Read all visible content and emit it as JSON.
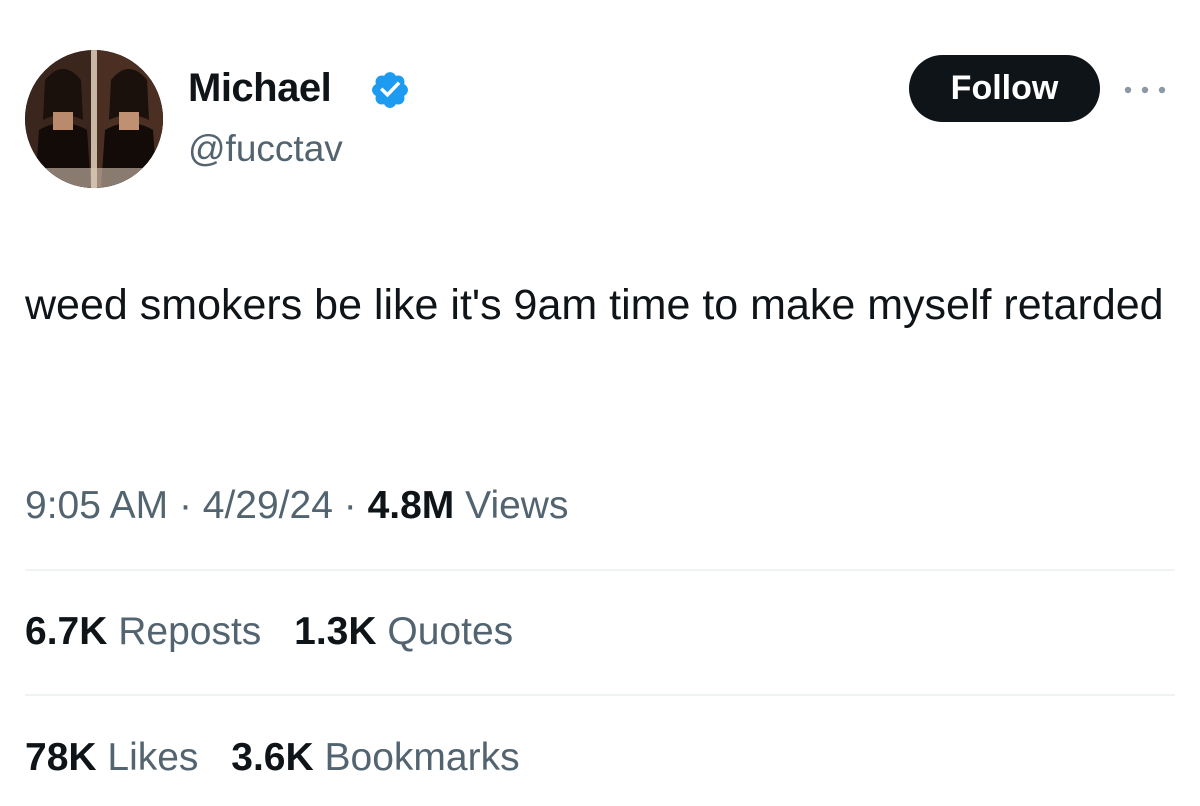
{
  "author": {
    "display_name": "Michael",
    "handle": "@fucctav",
    "verified": true,
    "avatar_icon": "profile-photo",
    "verified_color": "#1d9bf0"
  },
  "follow_button": {
    "label": "Follow"
  },
  "more_icon": "ellipsis-icon",
  "tweet": {
    "text": "weed smokers be like it's 9am time to make myself retarded"
  },
  "meta": {
    "time": "9:05 AM",
    "separator": "·",
    "date": "4/29/24",
    "views_count": "4.8M",
    "views_label": "Views"
  },
  "stats": {
    "reposts": {
      "count": "6.7K",
      "label": "Reposts"
    },
    "quotes": {
      "count": "1.3K",
      "label": "Quotes"
    },
    "likes": {
      "count": "78K",
      "label": "Likes"
    },
    "bookmarks": {
      "count": "3.6K",
      "label": "Bookmarks"
    }
  },
  "colors": {
    "text_primary": "#0f1419",
    "text_secondary": "#536471",
    "divider": "#eff3f4"
  }
}
